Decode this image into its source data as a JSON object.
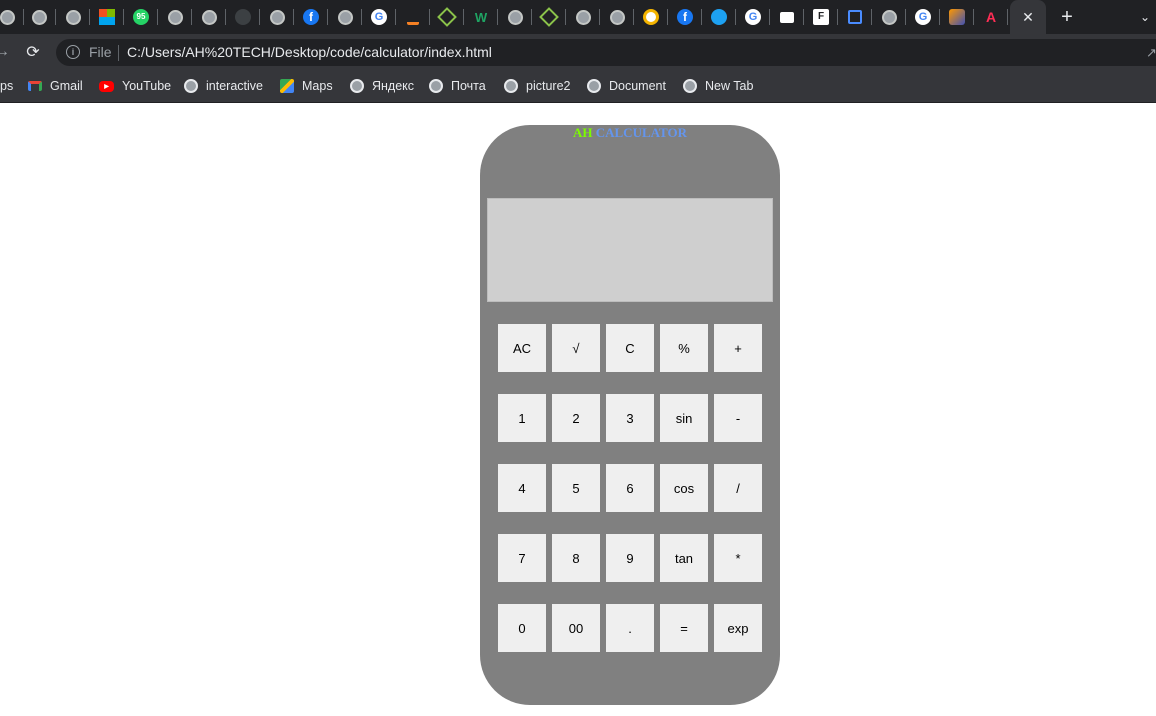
{
  "browser": {
    "colors": {
      "tabstrip": "#202124",
      "toolbar": "#35363a",
      "omnibox": "#202124",
      "text": "#e8eaed"
    },
    "tabs": [
      {
        "name": "globe",
        "label": ""
      },
      {
        "name": "globe",
        "label": ""
      },
      {
        "name": "globe",
        "label": ""
      },
      {
        "name": "windows",
        "label": ""
      },
      {
        "name": "badge",
        "label": "95"
      },
      {
        "name": "globe",
        "label": ""
      },
      {
        "name": "globe",
        "label": ""
      },
      {
        "name": "dark-logo",
        "label": ""
      },
      {
        "name": "globe",
        "label": ""
      },
      {
        "name": "facebook",
        "label": "f"
      },
      {
        "name": "globe",
        "label": ""
      },
      {
        "name": "google",
        "label": "G"
      },
      {
        "name": "stackoverflow",
        "label": ""
      },
      {
        "name": "cross",
        "label": ""
      },
      {
        "name": "w-logo",
        "label": "W"
      },
      {
        "name": "globe",
        "label": ""
      },
      {
        "name": "cross",
        "label": ""
      },
      {
        "name": "globe",
        "label": ""
      },
      {
        "name": "globe",
        "label": ""
      },
      {
        "name": "white-logo",
        "label": ""
      },
      {
        "name": "facebook",
        "label": "f"
      },
      {
        "name": "twitter",
        "label": ""
      },
      {
        "name": "google",
        "label": "G"
      },
      {
        "name": "flag-white",
        "label": ""
      },
      {
        "name": "f-box",
        "label": "F"
      },
      {
        "name": "flag-blue",
        "label": ""
      },
      {
        "name": "globe",
        "label": ""
      },
      {
        "name": "google",
        "label": "G"
      },
      {
        "name": "orange-logo",
        "label": ""
      },
      {
        "name": "a-logo",
        "label": "A"
      }
    ],
    "active_tab_close": "✕",
    "new_tab": "+",
    "tab_list": "⌄",
    "nav": {
      "back": "→",
      "reload": "⟳"
    },
    "omnibox": {
      "info": "i",
      "scheme_label": "File",
      "url": "C:/Users/AH%20TECH/Desktop/code/calculator/index.html"
    },
    "bookmarks": [
      {
        "label": "ps",
        "icon": ""
      },
      {
        "label": "Gmail",
        "icon": "gmail-icon"
      },
      {
        "label": "YouTube",
        "icon": "youtube-icon"
      },
      {
        "label": "interactive",
        "icon": "globe-icon"
      },
      {
        "label": "Maps",
        "icon": "maps-icon"
      },
      {
        "label": "Яндекс",
        "icon": "globe-icon"
      },
      {
        "label": "Почта",
        "icon": "globe-icon"
      },
      {
        "label": "picture2",
        "icon": "globe-icon"
      },
      {
        "label": "Document",
        "icon": "globe-icon"
      },
      {
        "label": "New Tab",
        "icon": "globe-icon"
      }
    ]
  },
  "calculator": {
    "title_prefix": "AH",
    "title_suffix": "CALCULATOR",
    "colors": {
      "body": "#808080",
      "display": "#cfcfcf",
      "key": "#efefef",
      "title_prefix": "#7cfc00",
      "title_suffix": "#6495ed"
    },
    "display_value": "",
    "rows": [
      [
        "AC",
        "√",
        "C",
        "%",
        "+"
      ],
      [
        "1",
        "2",
        "3",
        "sin",
        "-"
      ],
      [
        "4",
        "5",
        "6",
        "cos",
        "/"
      ],
      [
        "7",
        "8",
        "9",
        "tan",
        "*"
      ],
      [
        "0",
        "00",
        ".",
        "=",
        "exp"
      ]
    ]
  }
}
